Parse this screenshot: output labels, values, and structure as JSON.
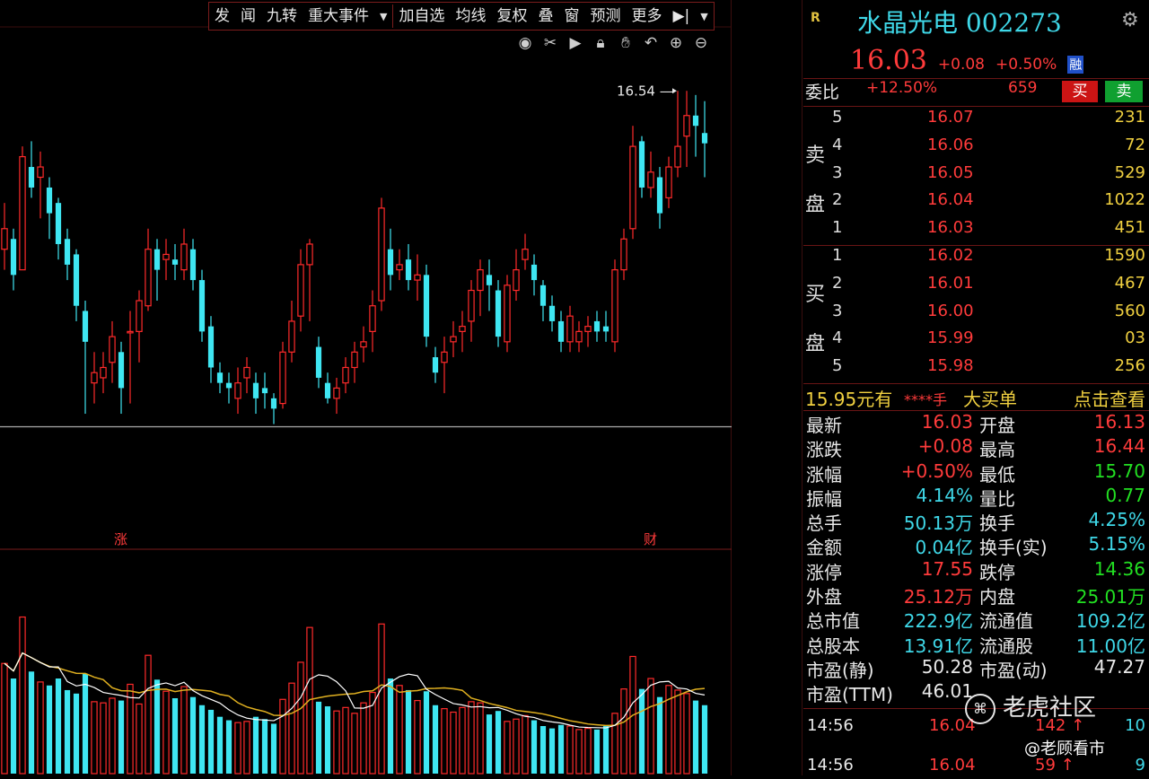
{
  "toolbar": {
    "items": [
      "发",
      "闻",
      "九转",
      "重大事件",
      "加自选",
      "均线",
      "复权",
      "叠",
      "窗",
      "预测",
      "更多"
    ]
  },
  "chart": {
    "price_axis": [
      "16.90",
      "15.46",
      "14.03",
      "12.57",
      "11.14"
    ],
    "volume_axis": [
      "17951",
      "12051",
      "6026",
      "X100"
    ],
    "high_label": "16.54",
    "markers": [
      "涨",
      "财"
    ],
    "colors": {
      "up": "#ff2a2a",
      "down": "#3fe6f2",
      "ma5": "#ffffff",
      "ma10": "#e0b020"
    }
  },
  "chart_data": {
    "type": "candlestick",
    "ylim": [
      12.1,
      16.9
    ],
    "candles": [
      [
        15.0,
        15.2,
        15.45,
        14.8
      ],
      [
        15.1,
        14.75,
        15.2,
        14.6
      ],
      [
        14.8,
        15.9,
        16.0,
        14.8
      ],
      [
        15.8,
        15.6,
        16.05,
        15.5
      ],
      [
        15.7,
        15.8,
        15.95,
        15.3
      ],
      [
        15.6,
        15.35,
        15.7,
        15.1
      ],
      [
        15.45,
        15.05,
        15.5,
        14.9
      ],
      [
        15.1,
        14.85,
        15.2,
        14.7
      ],
      [
        14.95,
        14.45,
        15.0,
        14.3
      ],
      [
        14.4,
        14.1,
        14.5,
        13.4
      ],
      [
        13.7,
        13.8,
        14.0,
        13.5
      ],
      [
        13.75,
        13.85,
        14.0,
        13.6
      ],
      [
        13.9,
        14.15,
        14.3,
        13.7
      ],
      [
        14.0,
        13.65,
        14.1,
        13.4
      ],
      [
        14.2,
        14.2,
        14.4,
        13.5
      ],
      [
        14.2,
        14.5,
        14.6,
        13.9
      ],
      [
        14.45,
        15.0,
        15.2,
        14.4
      ],
      [
        15.0,
        14.8,
        15.1,
        14.5
      ],
      [
        14.9,
        14.95,
        15.1,
        14.7
      ],
      [
        14.9,
        14.85,
        15.05,
        14.7
      ],
      [
        14.8,
        15.05,
        15.2,
        14.7
      ],
      [
        15.0,
        14.7,
        15.1,
        14.6
      ],
      [
        14.7,
        14.2,
        14.8,
        14.1
      ],
      [
        14.25,
        13.85,
        14.35,
        13.7
      ],
      [
        13.8,
        13.7,
        13.9,
        13.6
      ],
      [
        13.7,
        13.65,
        13.8,
        13.5
      ],
      [
        13.55,
        13.7,
        13.85,
        13.4
      ],
      [
        13.75,
        13.85,
        13.95,
        13.6
      ],
      [
        13.7,
        13.55,
        13.8,
        13.4
      ],
      [
        13.65,
        13.6,
        13.8,
        13.45
      ],
      [
        13.55,
        13.45,
        13.6,
        13.3
      ],
      [
        13.5,
        14.0,
        14.1,
        13.45
      ],
      [
        14.0,
        14.3,
        14.5,
        13.9
      ],
      [
        14.35,
        14.85,
        15.0,
        14.2
      ],
      [
        14.85,
        15.05,
        15.1,
        14.3
      ],
      [
        14.05,
        13.75,
        14.15,
        13.65
      ],
      [
        13.7,
        13.55,
        13.8,
        13.5
      ],
      [
        13.55,
        13.65,
        13.75,
        13.4
      ],
      [
        13.7,
        13.85,
        13.95,
        13.6
      ],
      [
        13.85,
        14.0,
        14.1,
        13.7
      ],
      [
        14.05,
        14.1,
        14.25,
        13.9
      ],
      [
        14.2,
        14.45,
        14.6,
        14.0
      ],
      [
        14.5,
        15.4,
        15.5,
        14.4
      ],
      [
        15.0,
        14.75,
        15.2,
        14.6
      ],
      [
        14.8,
        14.85,
        15.0,
        14.7
      ],
      [
        14.9,
        14.7,
        15.05,
        14.6
      ],
      [
        14.7,
        14.75,
        14.95,
        14.5
      ],
      [
        14.75,
        14.15,
        14.85,
        14.05
      ],
      [
        13.95,
        13.8,
        14.05,
        13.7
      ],
      [
        13.9,
        14.0,
        14.15,
        13.6
      ],
      [
        14.1,
        14.15,
        14.3,
        13.95
      ],
      [
        14.2,
        14.25,
        14.4,
        14.0
      ],
      [
        14.3,
        14.6,
        14.7,
        14.1
      ],
      [
        14.6,
        14.8,
        14.9,
        14.35
      ],
      [
        14.75,
        14.65,
        14.9,
        14.4
      ],
      [
        14.6,
        14.15,
        14.7,
        14.05
      ],
      [
        14.1,
        14.65,
        14.75,
        14.0
      ],
      [
        14.6,
        14.8,
        15.0,
        14.5
      ],
      [
        14.9,
        15.0,
        15.15,
        14.8
      ],
      [
        14.85,
        14.7,
        14.95,
        14.55
      ],
      [
        14.65,
        14.45,
        14.7,
        14.3
      ],
      [
        14.45,
        14.3,
        14.55,
        14.2
      ],
      [
        14.3,
        14.1,
        14.4,
        14.0
      ],
      [
        14.1,
        14.35,
        14.45,
        14.0
      ],
      [
        14.1,
        14.2,
        14.3,
        14.0
      ],
      [
        14.2,
        14.25,
        14.35,
        14.05
      ],
      [
        14.3,
        14.2,
        14.4,
        14.1
      ],
      [
        14.25,
        14.2,
        14.4,
        14.1
      ],
      [
        14.1,
        14.8,
        14.9,
        14.0
      ],
      [
        14.8,
        15.1,
        15.2,
        14.7
      ],
      [
        15.2,
        16.0,
        16.2,
        15.1
      ],
      [
        16.05,
        15.6,
        16.1,
        15.5
      ],
      [
        15.6,
        15.75,
        15.95,
        15.5
      ],
      [
        15.7,
        15.35,
        15.8,
        15.2
      ],
      [
        15.5,
        15.8,
        15.9,
        15.4
      ],
      [
        15.8,
        16.0,
        16.54,
        15.7
      ],
      [
        16.1,
        16.3,
        16.54,
        15.8
      ],
      [
        16.3,
        16.2,
        16.5,
        15.9
      ],
      [
        16.13,
        16.03,
        16.44,
        15.7
      ]
    ],
    "volume": [
      9500,
      8200,
      13500,
      8800,
      7900,
      7600,
      8200,
      7200,
      6900,
      8600,
      6200,
      6100,
      6500,
      6300,
      7700,
      6000,
      10200,
      8100,
      7100,
      6500,
      7500,
      6600,
      5900,
      5500,
      4900,
      4600,
      4400,
      4500,
      4900,
      4700,
      4300,
      6400,
      7800,
      9600,
      12600,
      6200,
      5800,
      5400,
      5700,
      5200,
      6100,
      7000,
      12900,
      8200,
      7600,
      7200,
      6300,
      7100,
      5900,
      5600,
      5300,
      5700,
      6200,
      6100,
      5100,
      5400,
      4500,
      4700,
      5000,
      4600,
      4100,
      3900,
      4200,
      4100,
      3800,
      3900,
      3800,
      4100,
      5200,
      7300,
      10100,
      7300,
      8200,
      6600,
      7600,
      7200,
      6900,
      6300,
      5900
    ]
  },
  "quote": {
    "r_logo": "R",
    "title": "水晶光电 002273",
    "price": "16.03",
    "change": "+0.08",
    "change_pct": "+0.50%",
    "rong": "融",
    "weibi_label": "委比",
    "weibi_pct": "+12.50%",
    "weibi_diff": "659",
    "buy_btn": "买",
    "sell_btn": "卖",
    "sell_label": [
      "卖",
      "盘"
    ],
    "buy_label": [
      "买",
      "盘"
    ],
    "asks": [
      {
        "level": "5",
        "price": "16.07",
        "vol": "231"
      },
      {
        "level": "4",
        "price": "16.06",
        "vol": "72"
      },
      {
        "level": "3",
        "price": "16.05",
        "vol": "529"
      },
      {
        "level": "2",
        "price": "16.04",
        "vol": "1022"
      },
      {
        "level": "1",
        "price": "16.03",
        "vol": "451"
      }
    ],
    "bids": [
      {
        "level": "1",
        "price": "16.02",
        "vol": "1590"
      },
      {
        "level": "2",
        "price": "16.01",
        "vol": "467"
      },
      {
        "level": "3",
        "price": "16.00",
        "vol": "560"
      },
      {
        "level": "4",
        "price": "15.99",
        "vol": "03"
      },
      {
        "level": "5",
        "price": "15.98",
        "vol": "256"
      }
    ],
    "bigorder": {
      "price": "15.95元有",
      "masked": "****手",
      "label": "大买单",
      "link": "点击查看"
    },
    "stats": [
      {
        "k1": "最新",
        "v1": "16.03",
        "c1": "red",
        "k2": "开盘",
        "v2": "16.13",
        "c2": "red"
      },
      {
        "k1": "涨跌",
        "v1": "+0.08",
        "c1": "red",
        "k2": "最高",
        "v2": "16.44",
        "c2": "red"
      },
      {
        "k1": "涨幅",
        "v1": "+0.50%",
        "c1": "red",
        "k2": "最低",
        "v2": "15.70",
        "c2": "green"
      },
      {
        "k1": "振幅",
        "v1": "4.14%",
        "c1": "cyan",
        "k2": "量比",
        "v2": "0.77",
        "c2": "green"
      },
      {
        "k1": "总手",
        "v1": "50.13万",
        "c1": "cyan",
        "k2": "换手",
        "v2": "4.25%",
        "c2": "cyan"
      },
      {
        "k1": "金额",
        "v1": "0.04亿",
        "c1": "cyan",
        "k2": "换手(实)",
        "v2": "5.15%",
        "c2": "cyan"
      },
      {
        "k1": "涨停",
        "v1": "17.55",
        "c1": "red",
        "k2": "跌停",
        "v2": "14.36",
        "c2": "green"
      },
      {
        "k1": "外盘",
        "v1": "25.12万",
        "c1": "red",
        "k2": "内盘",
        "v2": "25.01万",
        "c2": "green"
      },
      {
        "k1": "总市值",
        "v1": "222.9亿",
        "c1": "cyan",
        "k2": "流通值",
        "v2": "109.2亿",
        "c2": "cyan"
      },
      {
        "k1": "总股本",
        "v1": "13.91亿",
        "c1": "cyan",
        "k2": "流通股",
        "v2": "11.00亿",
        "c2": "cyan"
      },
      {
        "k1": "市盈(静)",
        "v1": "50.28",
        "c1": "white",
        "k2": "市盈(动)",
        "v2": "47.27",
        "c2": "white"
      },
      {
        "k1": "市盈(TTM)",
        "v1": "46.01",
        "c1": "white",
        "k2": "",
        "v2": "",
        "c2": "white"
      }
    ],
    "ticks": [
      {
        "time": "14:56",
        "price": "16.04",
        "vol": "142 ↑",
        "n": "10"
      },
      {
        "time": "14:56",
        "price": "16.04",
        "vol": "59 ↑",
        "n": "9"
      }
    ],
    "watermark": "老虎社区",
    "watermark2": "@老顾看市"
  }
}
